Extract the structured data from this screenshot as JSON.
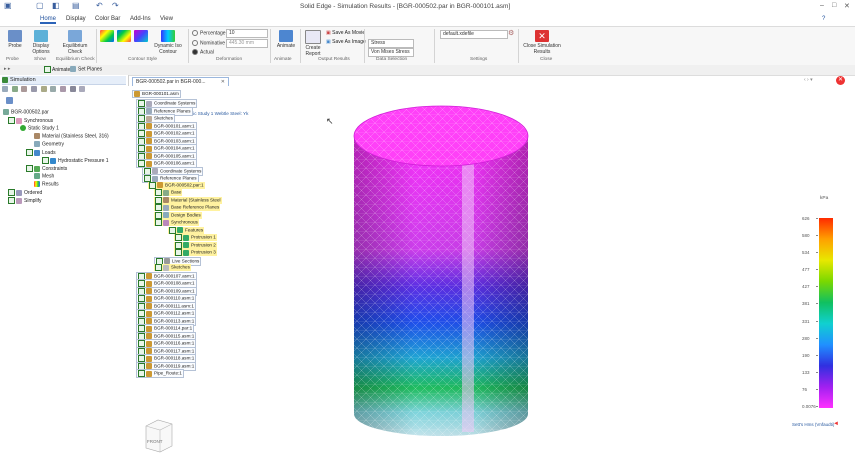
{
  "window": {
    "title": "Solid Edge - Simulation Results - [BGR-000502.par in BGR-000101.asm]",
    "controls": [
      "–",
      "□",
      "✕"
    ]
  },
  "ribbon_tabs": [
    "Home",
    "Display",
    "Color Bar",
    "Add-Ins",
    "View"
  ],
  "ribbon": {
    "probe": "Probe",
    "display_options": "Display Options",
    "equilibrium_check": "Equilibrium Check",
    "dynamic_iso_contour": "Dynamic Iso Contour",
    "percentage_label": "Percentage",
    "percentage_value": "10",
    "nominal_label": "Nominative",
    "nominal_value": "445.30 mm",
    "actual_label": "Actual",
    "animate": "Animate",
    "create_report": "Create Report",
    "save_as_movie": "Save As Movie",
    "save_as_image": "Save As Image",
    "data_type": "Stress",
    "data_component": "Von Mises Stress",
    "settings_value": "default.xdefile",
    "close_simulation": "Close Simulation Results",
    "groups": {
      "probe": "Probe",
      "show": "Show",
      "equilibrium": "Equilibrium Check",
      "contour": "Contour Style",
      "deformation": "Deformation",
      "animate": "Animate",
      "output": "Output Results",
      "data_selection": "Data Selection",
      "settings": "Settings",
      "close": "Close"
    }
  },
  "command_bar": {
    "animate": "Animate",
    "set_planes": "Set Planes"
  },
  "left_panel": {
    "title": "Simulation",
    "tree": [
      "BGR-000502.par",
      "Synchronous",
      "Static Study 1",
      "Material (Stainless Steel, 316)",
      "Geometry",
      "Loads",
      "Hydrostatic Pressure 1",
      "Constraints",
      "Mesh",
      "Results",
      "Ordered",
      "Simplify"
    ]
  },
  "document_tab": "BGR-000502.par in BGR-000...",
  "assembly_tree": {
    "root": "BGR-000101.asm",
    "study_label": "Static Study 1 Webtle Steel: Yk",
    "rows": [
      "Coordinate Systems",
      "Reference Planes",
      "Sketches",
      "BGR-000101.asm:1",
      "BGR-000102.asm:1",
      "BGR-000103.asm:1",
      "BGR-000104.asm:1",
      "BGR-000105.asm:1",
      "BGR-000106.asm:1",
      "Coordinate Systems",
      "Reference Planes",
      "BGR-000502.par:1",
      "Base",
      "Material (Stainless Steel",
      "Base Reference Planes",
      "Design Bodies",
      "Synchronous",
      "Features",
      "Protrusion 1",
      "Protrusion 2",
      "Protrusion 3",
      "Live Sections",
      "Sketches",
      "BGR-000107.asm:1",
      "BGR-000108.asm:1",
      "BGR-000109.asm:1",
      "BGR-000110.asm:1",
      "BGR-000111.asm:1",
      "BGR-000112.asm:1",
      "BGR-000113.asm:1",
      "BGR-000114.par:1",
      "BGR-000115.asm:1",
      "BGR-000116.asm:1",
      "BGR-000117.asm:1",
      "BGR-000118.asm:1",
      "BGR-000119.asm:1",
      "Pipe_Route:1"
    ]
  },
  "legend": {
    "unit": "kPa",
    "values": [
      "626",
      "580",
      "534",
      "477",
      "427",
      "381",
      "331",
      "280",
      "190",
      "133",
      "76",
      "0.0076"
    ],
    "note": "Sett's Hms (Vnfaudti)",
    "colors": [
      "#ff2a00",
      "#ffa000",
      "#e8e800",
      "#7ad800",
      "#10c060",
      "#10d0d0",
      "#2090ff",
      "#3030e0",
      "#a020f0",
      "#ff30ff"
    ]
  },
  "view_cube": {
    "label": "FRONT"
  }
}
